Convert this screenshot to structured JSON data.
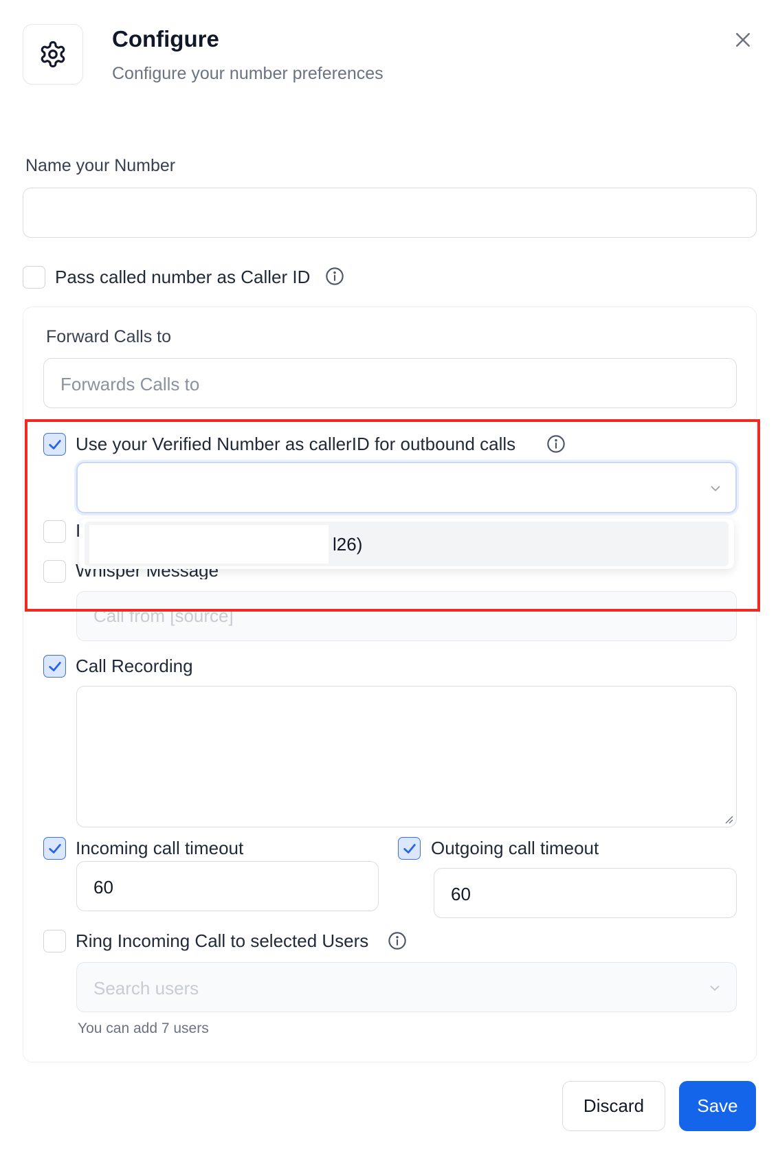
{
  "header": {
    "title": "Configure",
    "subtitle": "Configure your number preferences",
    "icon": "gear-icon",
    "close_icon": "close-icon"
  },
  "name_number": {
    "label": "Name your Number",
    "value": "",
    "placeholder": ""
  },
  "pass_called": {
    "label": "Pass called number as Caller ID",
    "checked": false
  },
  "forward": {
    "label": "Forward Calls to",
    "placeholder": "Forwards Calls to"
  },
  "verified_number": {
    "label": "Use your Verified Number as callerID for outbound calls",
    "checked": true,
    "selected": "",
    "dropdown_option": "l26)"
  },
  "hidden_row": {
    "partial_label": "I",
    "checked": false
  },
  "whisper": {
    "label": "Whisper Message",
    "checked": false,
    "placeholder": "Call from [source]"
  },
  "call_recording": {
    "label": "Call Recording",
    "checked": true,
    "value": ""
  },
  "incoming_timeout": {
    "label": "Incoming call timeout",
    "checked": true,
    "value": "60"
  },
  "outgoing_timeout": {
    "label": "Outgoing call timeout",
    "checked": true,
    "value": "60"
  },
  "ring_users": {
    "label": "Ring Incoming Call to selected Users",
    "checked": false,
    "placeholder": "Search users",
    "helper": "You can add 7 users"
  },
  "footer": {
    "discard_label": "Discard",
    "save_label": "Save"
  },
  "colors": {
    "primary": "#1565ea",
    "highlight": "#ee2a22",
    "checkbox_fill": "#dbe7ff"
  }
}
